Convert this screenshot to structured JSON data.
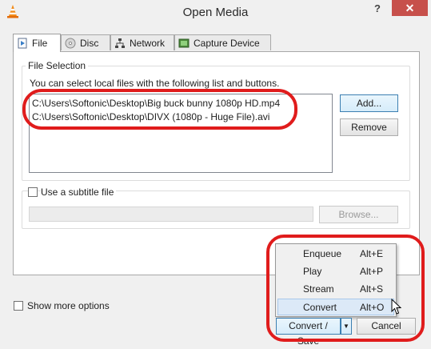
{
  "window": {
    "title": "Open Media",
    "help_label": "?",
    "close_label": "✕"
  },
  "tabs": [
    {
      "label": "File",
      "icon": "file-play-icon"
    },
    {
      "label": "Disc",
      "icon": "disc-icon"
    },
    {
      "label": "Network",
      "icon": "network-icon"
    },
    {
      "label": "Capture Device",
      "icon": "capture-device-icon"
    }
  ],
  "file_selection": {
    "legend": "File Selection",
    "instructions": "You can select local files with the following list and buttons.",
    "files": [
      "C:\\Users\\Softonic\\Desktop\\Big buck bunny 1080p HD.mp4",
      "C:\\Users\\Softonic\\Desktop\\DIVX (1080p - Huge File).avi"
    ],
    "add_label": "Add...",
    "remove_label": "Remove"
  },
  "subtitle": {
    "checkbox_label": "Use a subtitle file",
    "checked": false,
    "browse_label": "Browse..."
  },
  "show_more_label": "Show more options",
  "dropdown": {
    "items": [
      {
        "label": "Enqueue",
        "shortcut": "Alt+E"
      },
      {
        "label": "Play",
        "shortcut": "Alt+P"
      },
      {
        "label": "Stream",
        "shortcut": "Alt+S"
      },
      {
        "label": "Convert",
        "shortcut": "Alt+O"
      }
    ],
    "highlighted": "Convert"
  },
  "footer": {
    "convert_save_label": "Convert / Save",
    "arrow_label": "▼",
    "cancel_label": "Cancel"
  },
  "colors": {
    "highlight_ring": "#e01c1c",
    "close_button": "#c7504b",
    "menu_highlight": "#dce9f7"
  }
}
